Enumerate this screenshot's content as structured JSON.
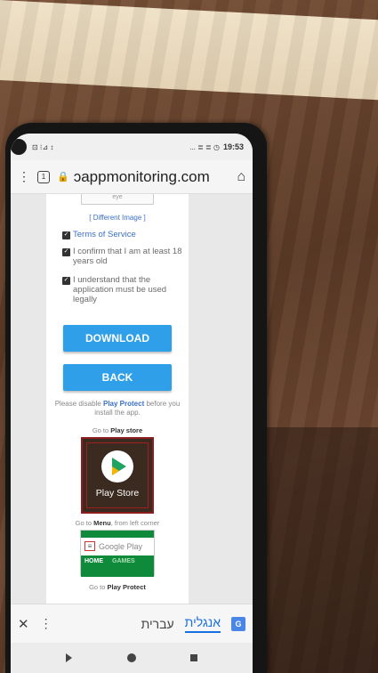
{
  "status": {
    "left_indicators": "⊡ ⁝⊿ ↕",
    "right_indicators": "... ≣ ≣ ◷",
    "time": "19:53"
  },
  "browser": {
    "tab_count": "1",
    "url": "ɔappmonitoring.com"
  },
  "form": {
    "captcha_placeholder": "eye",
    "different_image": "[ Different Image ]",
    "checkbox_tos": "Terms of Service",
    "checkbox_age": "I confirm that I am at least 18 years old",
    "checkbox_legal": "I understand that the application must be used legally",
    "download_label": "DOWNLOAD",
    "back_label": "BACK"
  },
  "instructions": {
    "disable_prefix": "Please disable",
    "disable_bold": "Play Protect",
    "disable_suffix": "before you install the app.",
    "goto_store_prefix": "Go to",
    "goto_store_bold": "Play store",
    "play_store_label": "Play Store",
    "goto_menu_prefix": "Go to",
    "goto_menu_bold": "Menu",
    "goto_menu_suffix": ", from left corner",
    "gplay_search": "Google Play",
    "gplay_tab_home": "HOME",
    "gplay_tab_games": "GAMES",
    "goto_protect_prefix": "Go to",
    "goto_protect_bold": "Play Protect"
  },
  "translate_bar": {
    "lang_hebrew": "עברית",
    "lang_english": "אנגלית",
    "translate_icon": "G"
  },
  "colors": {
    "button_blue": "#2f9fe9",
    "link_blue": "#3a6fc4",
    "gplay_green": "#0f8a3b"
  }
}
